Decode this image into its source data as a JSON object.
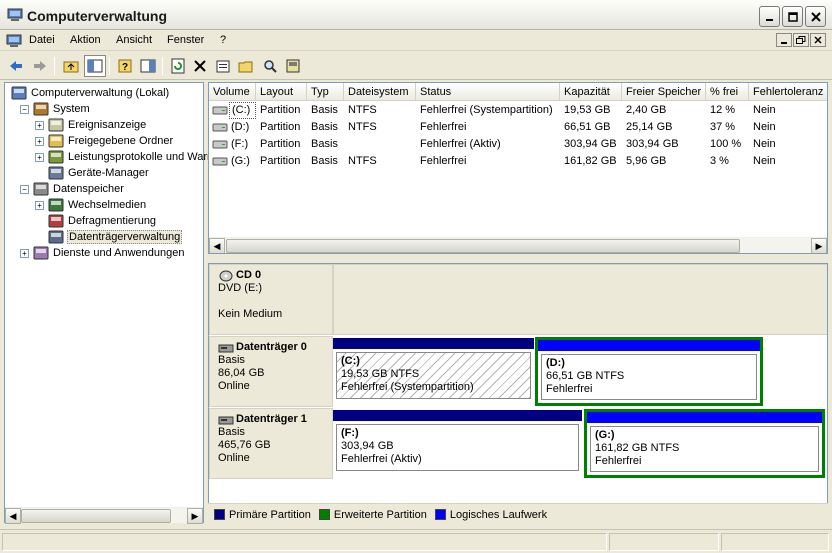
{
  "window": {
    "title": "Computerverwaltung"
  },
  "menu": [
    "Datei",
    "Aktion",
    "Ansicht",
    "Fenster",
    "?"
  ],
  "tree": [
    {
      "label": "Computerverwaltung (Lokal)",
      "icon": "computer-icon",
      "level": 0,
      "expander": ""
    },
    {
      "label": "System",
      "icon": "system-tools-icon",
      "level": 1,
      "expander": "-"
    },
    {
      "label": "Ereignisanzeige",
      "icon": "event-viewer-icon",
      "level": 2,
      "expander": "+"
    },
    {
      "label": "Freigegebene Ordner",
      "icon": "shared-folders-icon",
      "level": 2,
      "expander": "+"
    },
    {
      "label": "Leistungsprotokolle und Warnungen",
      "icon": "performance-logs-icon",
      "level": 2,
      "expander": "+"
    },
    {
      "label": "Geräte-Manager",
      "icon": "device-manager-icon",
      "level": 2,
      "expander": ""
    },
    {
      "label": "Datenspeicher",
      "icon": "storage-icon",
      "level": 1,
      "expander": "-"
    },
    {
      "label": "Wechselmedien",
      "icon": "removable-storage-icon",
      "level": 2,
      "expander": "+"
    },
    {
      "label": "Defragmentierung",
      "icon": "defragmenter-icon",
      "level": 2,
      "expander": ""
    },
    {
      "label": "Datenträgerverwaltung",
      "icon": "disk-management-icon",
      "level": 2,
      "expander": "",
      "selected": true
    },
    {
      "label": "Dienste und Anwendungen",
      "icon": "services-icon",
      "level": 1,
      "expander": "+"
    }
  ],
  "volumes": {
    "columns": [
      "Volume",
      "Layout",
      "Typ",
      "Dateisystem",
      "Status",
      "Kapazität",
      "Freier Speicher",
      "% frei",
      "Fehlertoleranz"
    ],
    "rows": [
      [
        "(C:)",
        "Partition",
        "Basis",
        "NTFS",
        "Fehlerfrei (Systempartition)",
        "19,53 GB",
        "2,40 GB",
        "12 %",
        "Nein"
      ],
      [
        "(D:)",
        "Partition",
        "Basis",
        "NTFS",
        "Fehlerfrei",
        "66,51 GB",
        "25,14 GB",
        "37 %",
        "Nein"
      ],
      [
        "(F:)",
        "Partition",
        "Basis",
        "",
        "Fehlerfrei (Aktiv)",
        "303,94 GB",
        "303,94 GB",
        "100 %",
        "Nein"
      ],
      [
        "(G:)",
        "Partition",
        "Basis",
        "NTFS",
        "Fehlerfrei",
        "161,82 GB",
        "5,96 GB",
        "3 %",
        "Nein"
      ]
    ]
  },
  "disks": {
    "cd": {
      "name": "CD 0",
      "type": "DVD (E:)",
      "status": "Kein Medium"
    },
    "disk0": {
      "name": "Datenträger 0",
      "type": "Basis",
      "size": "86,04 GB",
      "state": "Online",
      "parts": [
        {
          "letter": "(C:)",
          "size": "19,53 GB NTFS",
          "status": "Fehlerfrei (Systempartition)"
        },
        {
          "letter": "(D:)",
          "size": "66,51 GB NTFS",
          "status": "Fehlerfrei"
        }
      ]
    },
    "disk1": {
      "name": "Datenträger 1",
      "type": "Basis",
      "size": "465,76 GB",
      "state": "Online",
      "parts": [
        {
          "letter": "(F:)",
          "size": "303,94 GB",
          "status": "Fehlerfrei (Aktiv)"
        },
        {
          "letter": "(G:)",
          "size": "161,82 GB NTFS",
          "status": "Fehlerfrei"
        }
      ]
    }
  },
  "legend": [
    {
      "label": "Primäre Partition",
      "color": "#000080"
    },
    {
      "label": "Erweiterte Partition",
      "color": "#008000"
    },
    {
      "label": "Logisches Laufwerk",
      "color": "#0000ff"
    }
  ],
  "colors": {
    "primary": "#000080",
    "extended": "#008000",
    "logical": "#0000ff"
  }
}
